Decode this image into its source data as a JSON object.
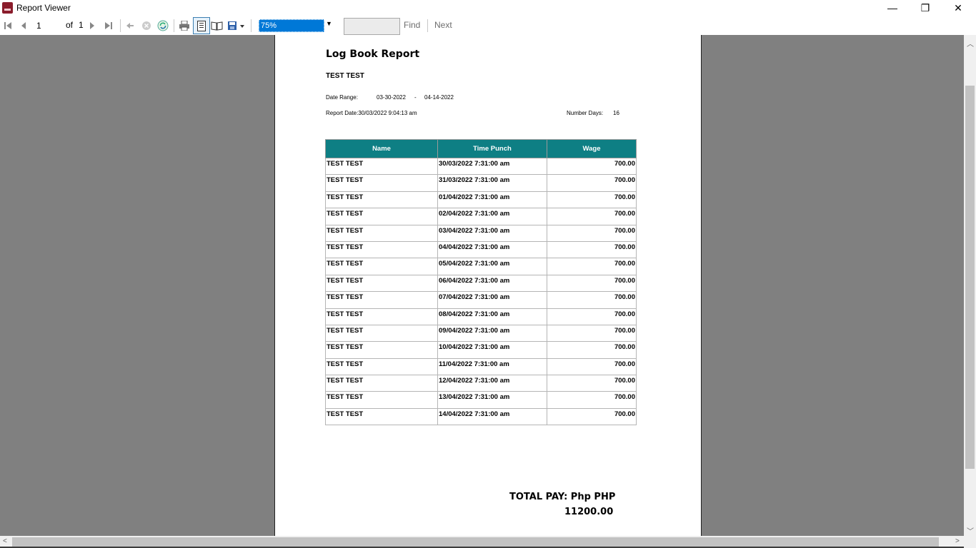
{
  "window": {
    "title": "Report Viewer",
    "minimize_glyph": "—",
    "maximize_glyph": "❐",
    "close_glyph": "✕"
  },
  "toolbar": {
    "current_page": "1",
    "of_label": "of",
    "total_pages": "1",
    "zoom": "75%",
    "find_label": "Find",
    "next_label": "Next",
    "icons": [
      "first-page-icon",
      "previous-page-icon",
      "next-page-icon",
      "last-page-icon",
      "back-icon",
      "stop-icon",
      "refresh-icon",
      "print-icon",
      "print-layout-icon",
      "page-setup-icon",
      "export-icon"
    ]
  },
  "report": {
    "title": "Log Book Report",
    "employee": "TEST TEST",
    "date_range_label": "Date Range:",
    "date_from": "03-30-2022",
    "date_dash": "-",
    "date_to": "04-14-2022",
    "report_date": "Report Date:30/03/2022 9:04:13 am",
    "number_days_label": "Number Days:",
    "number_days": "16",
    "columns": [
      "Name",
      "Time Punch",
      "Wage"
    ],
    "rows": [
      [
        "TEST TEST",
        "30/03/2022 7:31:00 am",
        "700.00"
      ],
      [
        "TEST TEST",
        "31/03/2022 7:31:00 am",
        "700.00"
      ],
      [
        "TEST TEST",
        "01/04/2022 7:31:00 am",
        "700.00"
      ],
      [
        "TEST TEST",
        "02/04/2022 7:31:00 am",
        "700.00"
      ],
      [
        "TEST TEST",
        "03/04/2022 7:31:00 am",
        "700.00"
      ],
      [
        "TEST TEST",
        "04/04/2022 7:31:00 am",
        "700.00"
      ],
      [
        "TEST TEST",
        "05/04/2022 7:31:00 am",
        "700.00"
      ],
      [
        "TEST TEST",
        "06/04/2022 7:31:00 am",
        "700.00"
      ],
      [
        "TEST TEST",
        "07/04/2022 7:31:00 am",
        "700.00"
      ],
      [
        "TEST TEST",
        "08/04/2022 7:31:00 am",
        "700.00"
      ],
      [
        "TEST TEST",
        "09/04/2022 7:31:00 am",
        "700.00"
      ],
      [
        "TEST TEST",
        "10/04/2022 7:31:00 am",
        "700.00"
      ],
      [
        "TEST TEST",
        "11/04/2022 7:31:00 am",
        "700.00"
      ],
      [
        "TEST TEST",
        "12/04/2022 7:31:00 am",
        "700.00"
      ],
      [
        "TEST TEST",
        "13/04/2022 7:31:00 am",
        "700.00"
      ],
      [
        "TEST TEST",
        "14/04/2022 7:31:00 am",
        "700.00"
      ]
    ],
    "total_label": "TOTAL PAY: Php PHP",
    "total_amount": "11200.00",
    "header_color": "#0e7f84"
  }
}
